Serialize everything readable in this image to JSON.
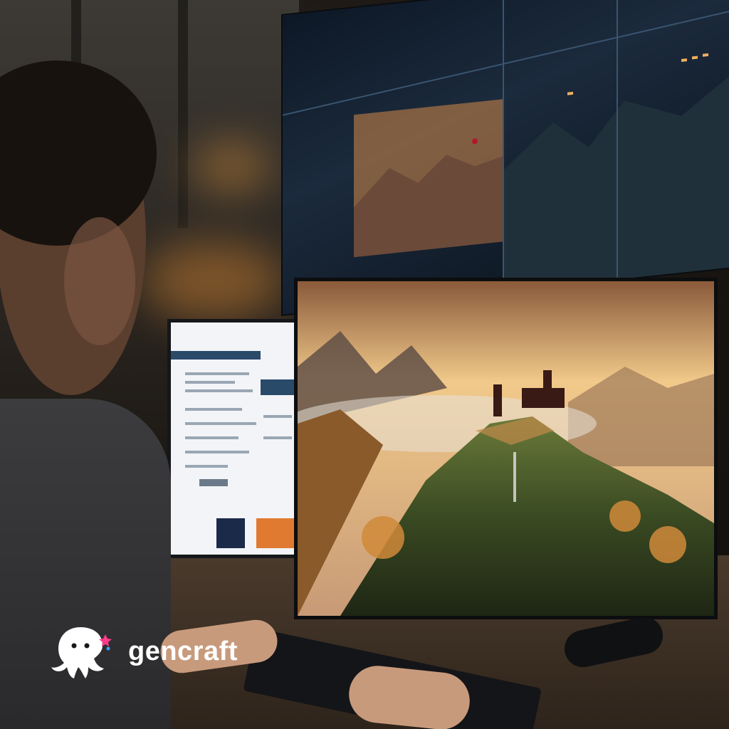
{
  "watermark": {
    "brand": "gencraft",
    "logo_icon": "octopus-icon"
  },
  "colors": {
    "sky_warm": "#f3c27a",
    "shadow": "#1a1612",
    "screen_blue": "#1b2a3c",
    "forest": "#3a4a2a"
  }
}
